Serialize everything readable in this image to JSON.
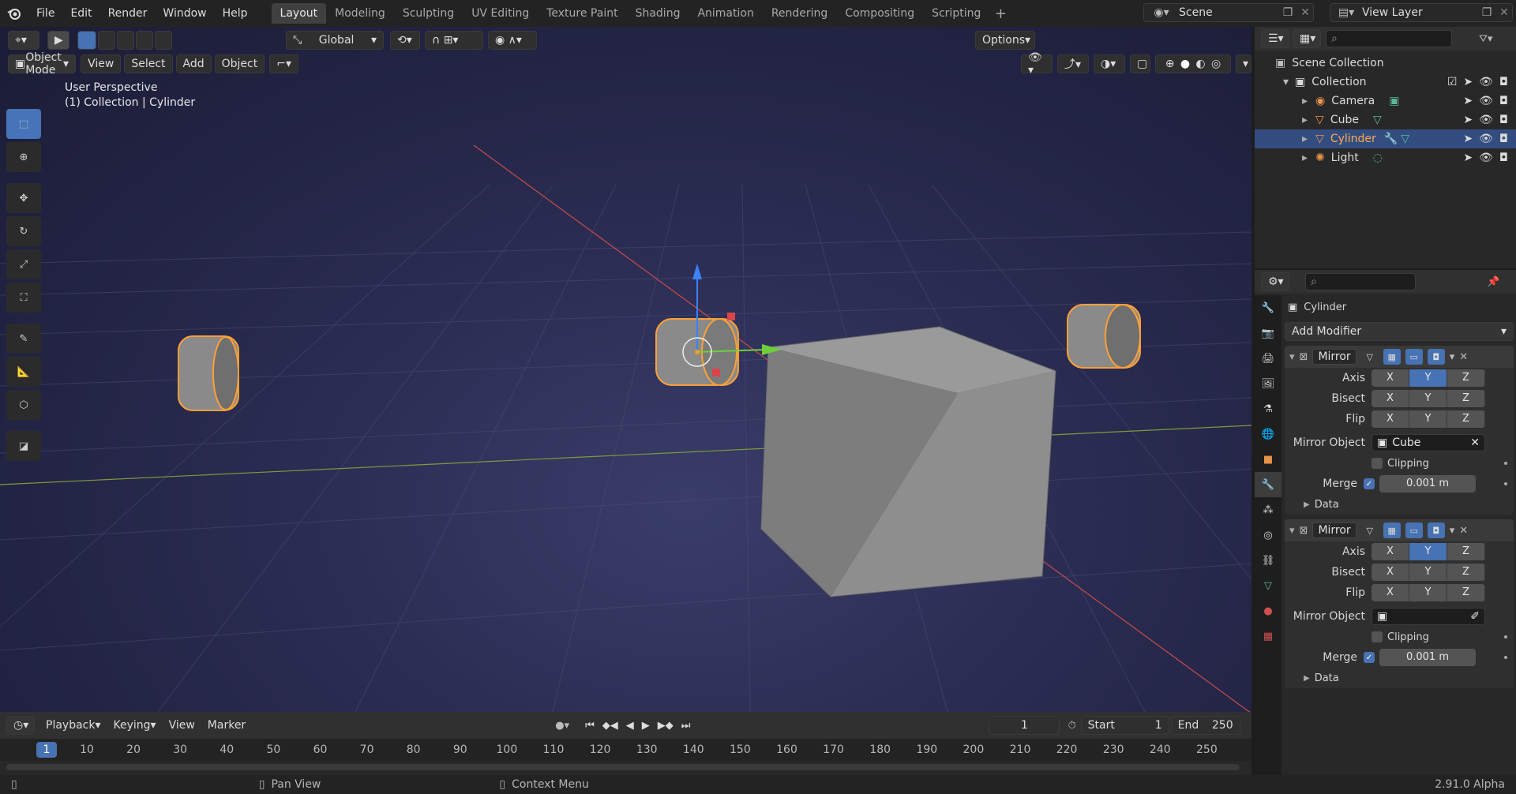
{
  "menu": [
    "File",
    "Edit",
    "Render",
    "Window",
    "Help"
  ],
  "workspaces": [
    "Layout",
    "Modeling",
    "Sculpting",
    "UV Editing",
    "Texture Paint",
    "Shading",
    "Animation",
    "Rendering",
    "Compositing",
    "Scripting"
  ],
  "scene_name": "Scene",
  "view_layer": "View Layer",
  "viewport": {
    "mode": "Object Mode",
    "menus": [
      "View",
      "Select",
      "Add",
      "Object"
    ],
    "transform_orientation": "Global",
    "options_label": "Options",
    "overlay_line1": "User Perspective",
    "overlay_line2": "(1) Collection | Cylinder"
  },
  "outliner": {
    "scene_collection": "Scene Collection",
    "collection": "Collection",
    "items": [
      {
        "name": "Camera",
        "icon": "camera-icon",
        "selected": false
      },
      {
        "name": "Cube",
        "icon": "mesh-icon",
        "selected": false
      },
      {
        "name": "Cylinder",
        "icon": "mesh-icon",
        "selected": true
      },
      {
        "name": "Light",
        "icon": "light-icon",
        "selected": false
      }
    ]
  },
  "properties": {
    "object_name": "Cylinder",
    "add_modifier": "Add Modifier",
    "modifiers": [
      {
        "name": "Mirror",
        "axis_label": "Axis",
        "bisect_label": "Bisect",
        "flip_label": "Flip",
        "axis": [
          "X",
          "Y",
          "Z"
        ],
        "axis_on": [
          false,
          true,
          false
        ],
        "mirror_object_label": "Mirror Object",
        "mirror_object": "Cube",
        "clipping_label": "Clipping",
        "merge_label": "Merge",
        "merge_value": "0.001 m",
        "data_label": "Data"
      },
      {
        "name": "Mirror",
        "axis_label": "Axis",
        "bisect_label": "Bisect",
        "flip_label": "Flip",
        "axis": [
          "X",
          "Y",
          "Z"
        ],
        "axis_on": [
          false,
          true,
          false
        ],
        "mirror_object_label": "Mirror Object",
        "mirror_object": "",
        "clipping_label": "Clipping",
        "merge_label": "Merge",
        "merge_value": "0.001 m",
        "data_label": "Data"
      }
    ]
  },
  "timeline": {
    "menus": [
      "Playback",
      "Keying",
      "View",
      "Marker"
    ],
    "current_frame": "1",
    "start_label": "Start",
    "start": "1",
    "end_label": "End",
    "end": "250",
    "ruler": [
      "1",
      "10",
      "20",
      "30",
      "40",
      "50",
      "60",
      "70",
      "80",
      "90",
      "100",
      "110",
      "120",
      "130",
      "140",
      "150",
      "160",
      "170",
      "180",
      "190",
      "200",
      "210",
      "220",
      "230",
      "240",
      "250"
    ]
  },
  "status": {
    "pan_view": "Pan View",
    "context_menu": "Context Menu",
    "version": "2.91.0 Alpha"
  }
}
